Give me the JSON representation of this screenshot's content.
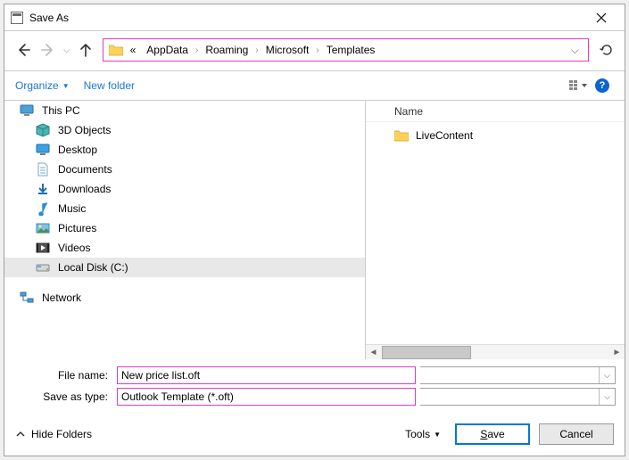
{
  "window": {
    "title": "Save As"
  },
  "breadcrumb": {
    "overflow_label": "«",
    "parts": [
      "AppData",
      "Roaming",
      "Microsoft",
      "Templates"
    ],
    "refresh_icon": "refresh"
  },
  "toolbar": {
    "organize": "Organize",
    "new_folder": "New folder",
    "view_icon": "view-details",
    "help_icon": "help"
  },
  "tree": {
    "items": [
      {
        "label": "This PC",
        "icon": "pc"
      },
      {
        "label": "3D Objects",
        "icon": "3d"
      },
      {
        "label": "Desktop",
        "icon": "desktop"
      },
      {
        "label": "Documents",
        "icon": "documents"
      },
      {
        "label": "Downloads",
        "icon": "downloads"
      },
      {
        "label": "Music",
        "icon": "music"
      },
      {
        "label": "Pictures",
        "icon": "pictures"
      },
      {
        "label": "Videos",
        "icon": "videos"
      },
      {
        "label": "Local Disk (C:)",
        "icon": "disk",
        "selected": true
      },
      {
        "label": "Network",
        "icon": "network",
        "top_spacer": true
      }
    ]
  },
  "filespane": {
    "column_header": "Name",
    "items": [
      {
        "label": "LiveContent",
        "icon": "folder"
      }
    ]
  },
  "inputs": {
    "file_name_label": "File name:",
    "file_name_value": "New price list.oft",
    "save_type_label": "Save as type:",
    "save_type_value": "Outlook Template (*.oft)"
  },
  "footer": {
    "hide_folders": "Hide Folders",
    "tools": "Tools",
    "save": "Save",
    "cancel": "Cancel"
  }
}
